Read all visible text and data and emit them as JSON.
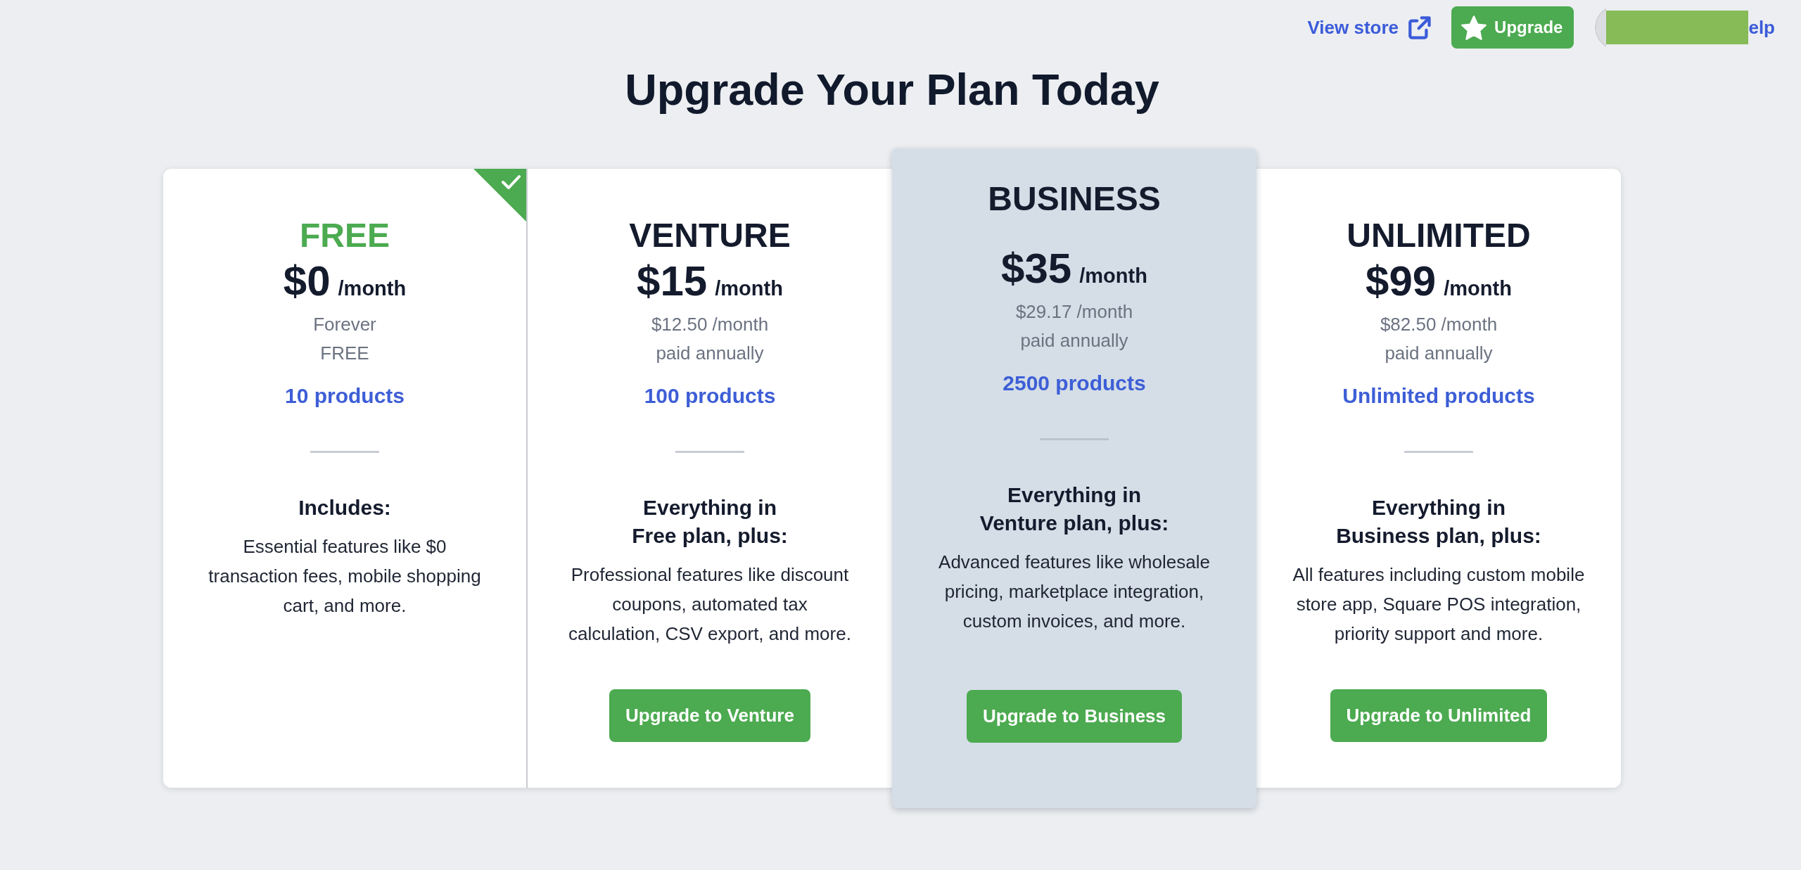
{
  "top_bar": {
    "view_store_link": "View store",
    "upgrade_button": "Upgrade",
    "help_link": "elp"
  },
  "title": "Upgrade Your Plan Today",
  "plans": [
    {
      "name": "FREE",
      "price": "$0",
      "period": "/month",
      "note": "Forever\nFREE",
      "products": "10 products",
      "heading": "Includes:",
      "description": "Essential features like $0\ntransaction fees, mobile shopping\ncart, and more.",
      "current": true,
      "featured": false
    },
    {
      "name": "VENTURE",
      "price": "$15",
      "period": "/month",
      "note": "$12.50 /month\npaid annually",
      "products": "100 products",
      "heading": "Everything in\nFree plan, plus:",
      "description": "Professional features like discount\ncoupons, automated tax\ncalculation, CSV export, and more.",
      "button": "Upgrade to Venture",
      "current": false,
      "featured": false
    },
    {
      "name": "BUSINESS",
      "price": "$35",
      "period": "/month",
      "note": "$29.17 /month\npaid annually",
      "products": "2500 products",
      "heading": "Everything in\nVenture plan, plus:",
      "description": "Advanced features like wholesale\npricing, marketplace integration,\ncustom invoices, and more.",
      "button": "Upgrade to Business",
      "current": false,
      "featured": true
    },
    {
      "name": "UNLIMITED",
      "price": "$99",
      "period": "/month",
      "note": "$82.50 /month\npaid annually",
      "products": "Unlimited products",
      "heading": "Everything in\nBusiness plan, plus:",
      "description": "All features including custom mobile\nstore app, Square POS integration,\npriority support and more.",
      "button": "Upgrade to Unlimited",
      "current": false,
      "featured": false
    }
  ]
}
